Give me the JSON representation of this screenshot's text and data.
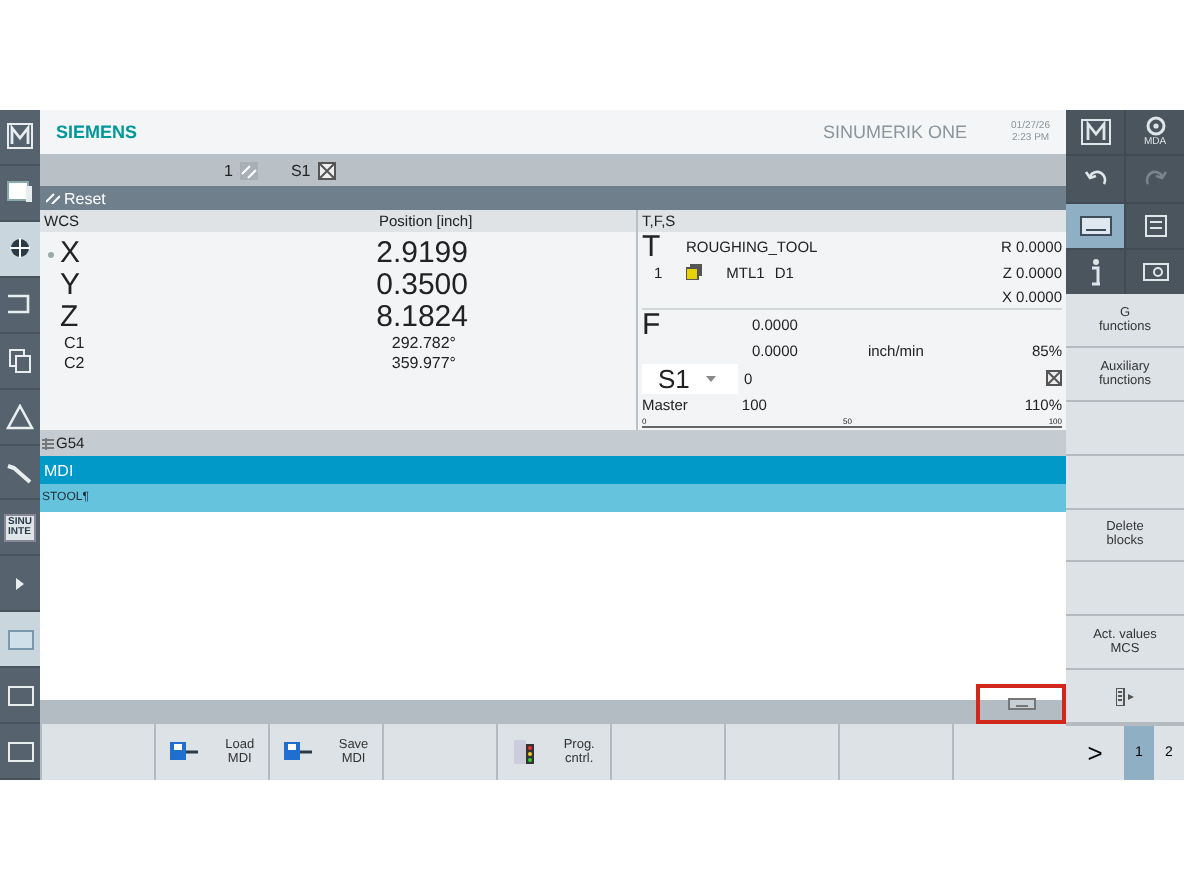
{
  "sidebar": [
    {
      "kind": "machine",
      "selected": false
    },
    {
      "kind": "window",
      "selected": false
    },
    {
      "kind": "target",
      "selected": true
    },
    {
      "kind": "bracket",
      "selected": false
    },
    {
      "kind": "copy",
      "selected": false
    },
    {
      "kind": "triangle",
      "selected": false
    },
    {
      "kind": "wrench",
      "selected": false
    },
    {
      "kind": "sinu",
      "label": "SINU\nINTE",
      "selected": false
    },
    {
      "kind": "arrow",
      "selected": false
    },
    {
      "kind": "screen",
      "selected": true
    },
    {
      "kind": "screen",
      "selected": false
    },
    {
      "kind": "screen",
      "selected": false
    }
  ],
  "header": {
    "brand": "SIEMENS",
    "product": "SINUMERIK ONE",
    "date": "01/27/26",
    "time": "2:23 PM"
  },
  "channel_bar": {
    "channel": "1",
    "spindle": "S1"
  },
  "status": {
    "text": "Reset"
  },
  "wcs": {
    "title": "WCS",
    "column": "Position [inch]",
    "axes": [
      {
        "name": "X",
        "value": "2.9199",
        "kind": "main",
        "active": true
      },
      {
        "name": "Y",
        "value": "0.3500",
        "kind": "main",
        "active": false
      },
      {
        "name": "Z",
        "value": "8.1824",
        "kind": "main",
        "active": false
      },
      {
        "name": "C1",
        "value": "292.782°",
        "kind": "minor",
        "active": false
      },
      {
        "name": "C2",
        "value": "359.977°",
        "kind": "minor",
        "active": false
      }
    ]
  },
  "tfs": {
    "title": "T,F,S",
    "tool_letter": "T",
    "tool": "ROUGHING_TOOL",
    "tool_number": "1",
    "magazine": "MTL1",
    "edge": "D1",
    "offsets": [
      "R 0.0000",
      "Z 0.0000",
      "X 0.0000"
    ],
    "feed_letter": "F",
    "feed": "0.0000",
    "feed_actual": "0.0000",
    "feed_unit": "inch/min",
    "feed_override": "85%",
    "spindle": "S1",
    "spindle_speed": "0",
    "spindle_mode": "Master",
    "spindle_value": "100",
    "spindle_override": "110%",
    "scale": [
      "0",
      "50",
      "100"
    ]
  },
  "work_offset": "G54",
  "editor": {
    "title": "MDI",
    "lines": [
      {
        "text": "STOOL¶",
        "selected": true
      }
    ],
    "keyboard_highlighted": true
  },
  "softkeys_bottom": [
    {
      "kind": "blank"
    },
    {
      "kind": "load",
      "label": "Load\nMDI"
    },
    {
      "kind": "save",
      "label": "Save\nMDI"
    },
    {
      "kind": "blank"
    },
    {
      "kind": "program-control",
      "label": "Prog.\ncntrl."
    },
    {
      "kind": "blank"
    },
    {
      "kind": "blank"
    },
    {
      "kind": "blank"
    },
    {
      "kind": "blank"
    }
  ],
  "toolbar_right": [
    {
      "kind": "machine",
      "selected": false,
      "disabled": false
    },
    {
      "kind": "mda",
      "label": "MDA",
      "selected": false,
      "disabled": false
    },
    {
      "kind": "undo",
      "selected": false,
      "disabled": false
    },
    {
      "kind": "redo",
      "selected": false,
      "disabled": true
    },
    {
      "kind": "keyboard",
      "selected": true,
      "disabled": false
    },
    {
      "kind": "calculator",
      "selected": false,
      "disabled": false
    },
    {
      "kind": "info",
      "selected": false,
      "disabled": false
    },
    {
      "kind": "screenshot",
      "selected": false,
      "disabled": false
    }
  ],
  "softkeys_right": [
    {
      "kind": "text",
      "label": "G\nfunctions"
    },
    {
      "kind": "text",
      "label": "Auxiliary\nfunctions"
    },
    {
      "kind": "blank"
    },
    {
      "kind": "blank"
    },
    {
      "kind": "text",
      "label": "Delete\nblocks"
    },
    {
      "kind": "blank"
    },
    {
      "kind": "text",
      "label": "Act. values\nMCS"
    },
    {
      "kind": "more"
    }
  ],
  "page_nav": {
    "next": ">",
    "pages": [
      {
        "label": "1",
        "selected": true
      },
      {
        "label": "2",
        "selected": false
      }
    ]
  }
}
